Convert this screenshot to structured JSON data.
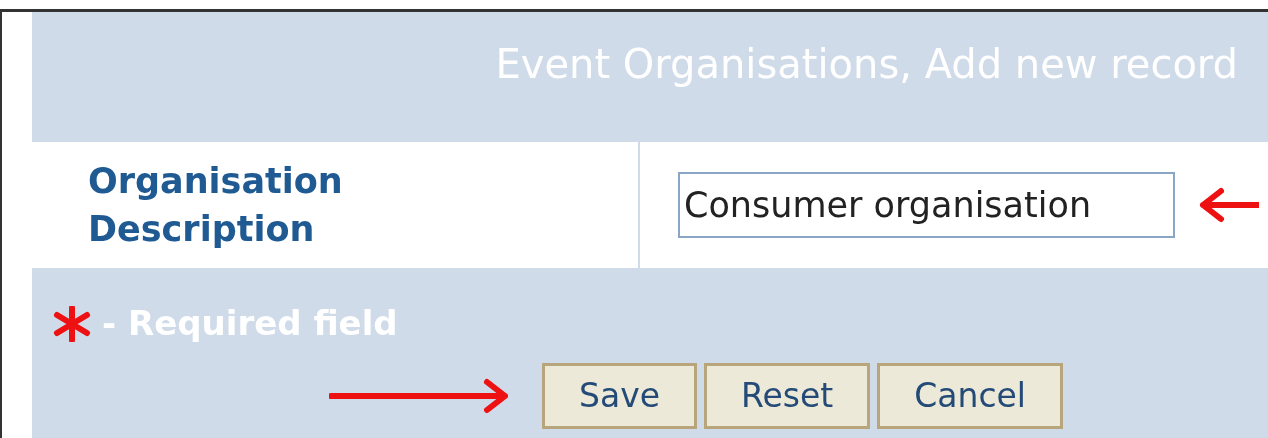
{
  "form": {
    "title": "Event Organisations, Add new record",
    "fields": [
      {
        "label": "Organisation Description",
        "value": "Consumer organisation"
      }
    ],
    "required_note": "- Required field",
    "buttons": [
      {
        "label": "Save"
      },
      {
        "label": "Reset"
      },
      {
        "label": "Cancel"
      }
    ]
  }
}
